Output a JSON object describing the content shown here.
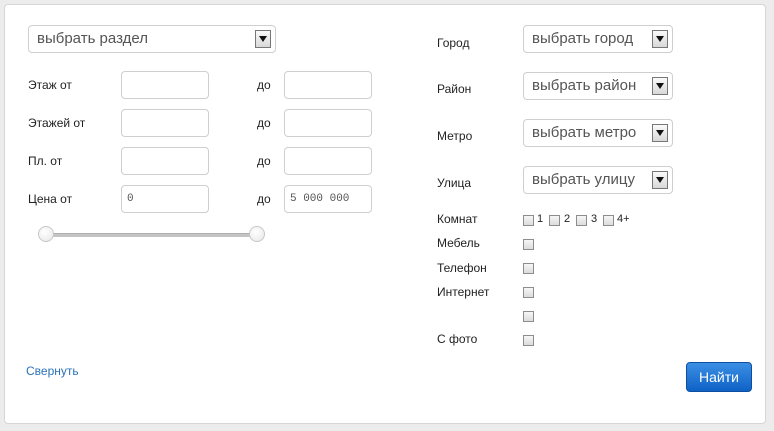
{
  "section_select": {
    "value": "выбрать раздел"
  },
  "left_filters": {
    "to_label": "до",
    "rows": [
      {
        "label": "Этаж от",
        "from": "",
        "to": ""
      },
      {
        "label": "Этажей от",
        "from": "",
        "to": ""
      },
      {
        "label": "Пл. от",
        "from": "",
        "to": ""
      },
      {
        "label": "Цена от",
        "from": "0",
        "to": "5 000 000"
      }
    ]
  },
  "price_slider": {
    "min_value": "0",
    "max_value": "5 000 000"
  },
  "right_filters": {
    "city": {
      "label": "Город",
      "value": "выбрать город"
    },
    "district": {
      "label": "Район",
      "value": "выбрать район"
    },
    "metro": {
      "label": "Метро",
      "value": "выбрать метро"
    },
    "street": {
      "label": "Улица",
      "value": "выбрать улицу"
    },
    "rooms": {
      "label": "Комнат",
      "options": [
        "1",
        "2",
        "3",
        "4+"
      ]
    },
    "furniture": {
      "label": "Мебель"
    },
    "phone": {
      "label": "Телефон"
    },
    "internet": {
      "label": "Интернет"
    },
    "unlabeled": {
      "label": ""
    },
    "with_photo": {
      "label": "С фото"
    }
  },
  "collapse_link": "Свернуть",
  "search_button": "Найти"
}
